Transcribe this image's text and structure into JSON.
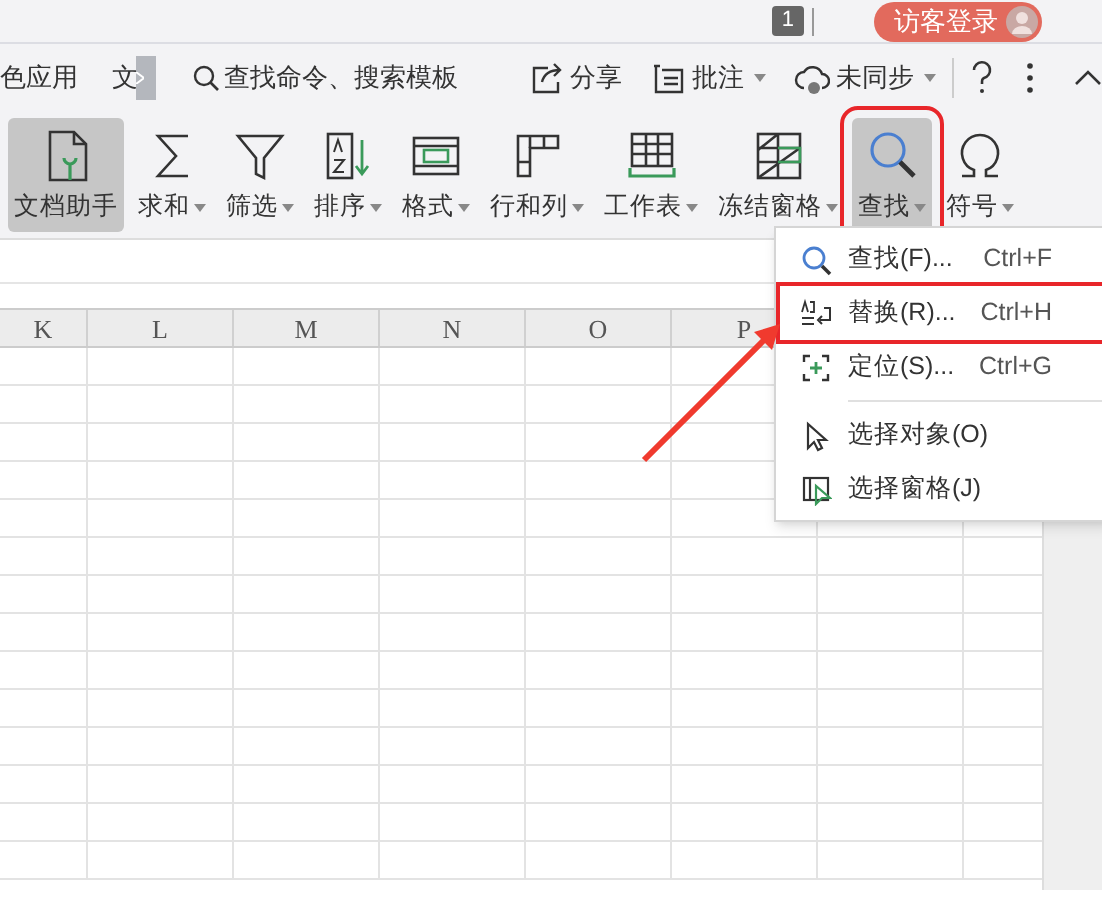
{
  "top_bar": {
    "badge": "1",
    "login_button": "访客登录"
  },
  "menu_bar": {
    "tabs": [
      {
        "label": "色应用"
      },
      {
        "label": "文"
      }
    ],
    "search": "查找命令、搜索模板",
    "actions": [
      {
        "label": "分享",
        "kind": "share",
        "dropdown": false
      },
      {
        "label": "批注",
        "kind": "comment",
        "dropdown": true
      },
      {
        "label": "未同步",
        "kind": "sync",
        "dropdown": true
      }
    ]
  },
  "ribbon": [
    {
      "label": "文档助手",
      "kind": "assistant",
      "dropdown": false,
      "selected": true,
      "annotated": false
    },
    {
      "label": "求和",
      "kind": "sum",
      "dropdown": true,
      "selected": false,
      "annotated": false
    },
    {
      "label": "筛选",
      "kind": "filter",
      "dropdown": true,
      "selected": false,
      "annotated": false
    },
    {
      "label": "排序",
      "kind": "sort",
      "dropdown": true,
      "selected": false,
      "annotated": false
    },
    {
      "label": "格式",
      "kind": "format",
      "dropdown": true,
      "selected": false,
      "annotated": false
    },
    {
      "label": "行和列",
      "kind": "rowcol",
      "dropdown": true,
      "selected": false,
      "annotated": false
    },
    {
      "label": "工作表",
      "kind": "sheet",
      "dropdown": true,
      "selected": false,
      "annotated": false
    },
    {
      "label": "冻结窗格",
      "kind": "freeze",
      "dropdown": true,
      "selected": false,
      "annotated": false
    },
    {
      "label": "查找",
      "kind": "find",
      "dropdown": true,
      "selected": true,
      "annotated": true
    },
    {
      "label": "符号",
      "kind": "symbol",
      "dropdown": true,
      "selected": false,
      "annotated": false
    }
  ],
  "sheet": {
    "columns": [
      "K",
      "L",
      "M",
      "N",
      "O",
      "P"
    ]
  },
  "dropdown_menu": [
    {
      "label": "查找(F)...",
      "shortcut": "Ctrl+F",
      "kind": "find",
      "annotated": false
    },
    {
      "label": "替换(R)...",
      "shortcut": "Ctrl+H",
      "kind": "replace",
      "annotated": true
    },
    {
      "label": "定位(S)...",
      "shortcut": "Ctrl+G",
      "kind": "goto",
      "annotated": false
    },
    {
      "label": "选择对象(O)",
      "kind": "pointer",
      "annotated": false
    },
    {
      "label": "选择窗格(J)",
      "kind": "pane",
      "annotated": false
    }
  ]
}
